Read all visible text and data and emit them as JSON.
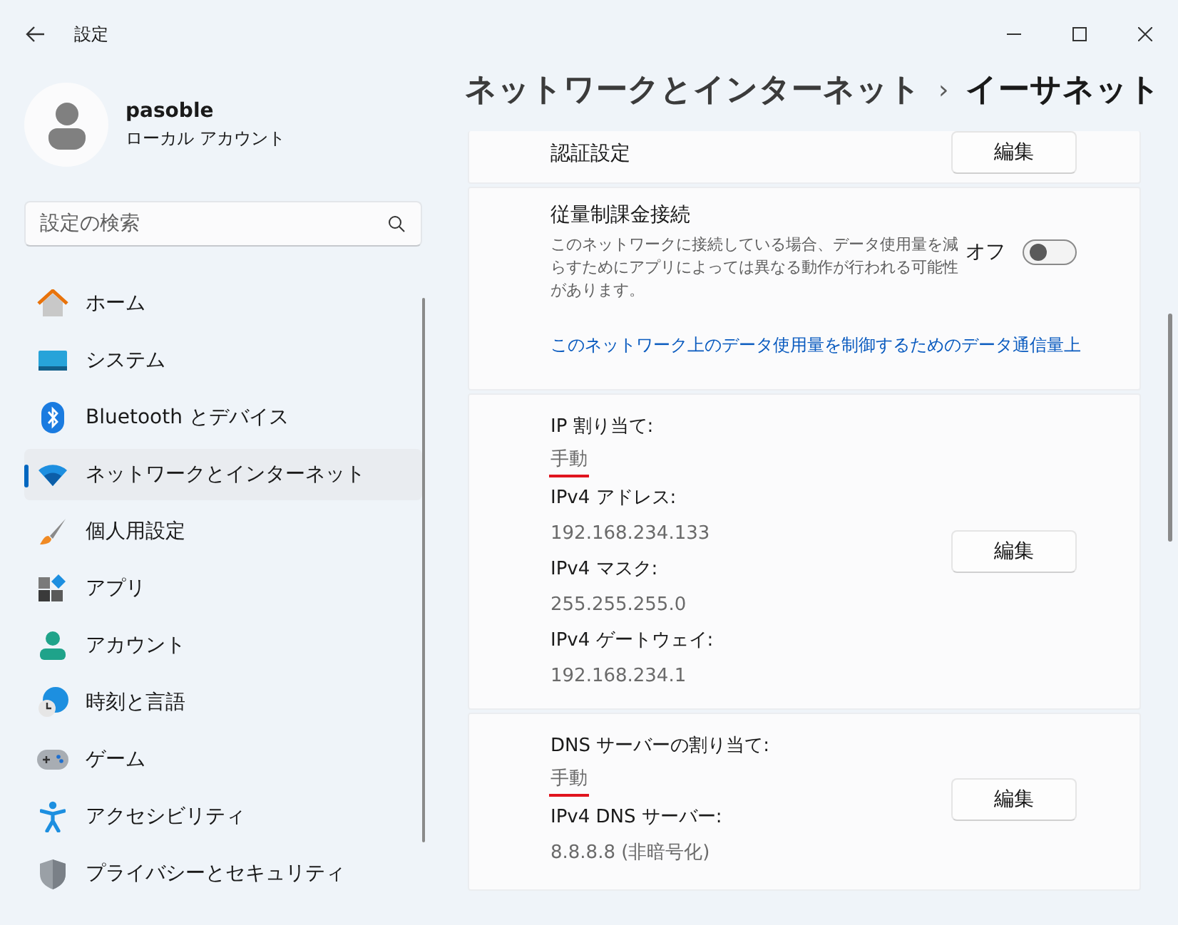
{
  "window": {
    "title": "設定"
  },
  "user": {
    "name": "pasoble",
    "account_type": "ローカル アカウント"
  },
  "search": {
    "placeholder": "設定の検索"
  },
  "nav": [
    {
      "label": "ホーム",
      "kind": "home",
      "selected": false
    },
    {
      "label": "システム",
      "kind": "system",
      "selected": false
    },
    {
      "label": "Bluetooth とデバイス",
      "kind": "bluetooth",
      "selected": false
    },
    {
      "label": "ネットワークとインターネット",
      "kind": "network",
      "selected": true
    },
    {
      "label": "個人用設定",
      "kind": "brush",
      "selected": false
    },
    {
      "label": "アプリ",
      "kind": "apps",
      "selected": false
    },
    {
      "label": "アカウント",
      "kind": "account",
      "selected": false
    },
    {
      "label": "時刻と言語",
      "kind": "time",
      "selected": false
    },
    {
      "label": "ゲーム",
      "kind": "game",
      "selected": false
    },
    {
      "label": "アクセシビリティ",
      "kind": "accessibility",
      "selected": false
    },
    {
      "label": "プライバシーとセキュリティ",
      "kind": "shield",
      "selected": false
    }
  ],
  "breadcrumb": {
    "parent": "ネットワークとインターネット",
    "separator": "›",
    "current": "イーサネット"
  },
  "auth": {
    "label": "認証設定",
    "button": "編集"
  },
  "metered": {
    "title": "従量制課金接続",
    "description": "このネットワークに接続している場合、データ使用量を減らすためにアプリによっては異なる動作が行われる可能性があります。",
    "state_label": "オフ",
    "on": false,
    "link": "このネットワーク上のデータ使用量を制御するためのデータ通信量上"
  },
  "ip": {
    "button": "編集",
    "lines": [
      {
        "text": "IP 割り当て:",
        "kind": "label",
        "marked": false
      },
      {
        "text": "手動",
        "kind": "value",
        "marked": true
      },
      {
        "text": "IPv4 アドレス:",
        "kind": "label",
        "marked": false
      },
      {
        "text": "192.168.234.133",
        "kind": "value",
        "marked": false
      },
      {
        "text": "IPv4 マスク:",
        "kind": "label",
        "marked": false
      },
      {
        "text": "255.255.255.0",
        "kind": "value",
        "marked": false
      },
      {
        "text": "IPv4 ゲートウェイ:",
        "kind": "label",
        "marked": false
      },
      {
        "text": "192.168.234.1",
        "kind": "value",
        "marked": false
      }
    ]
  },
  "dns": {
    "button": "編集",
    "lines": [
      {
        "text": "DNS サーバーの割り当て:",
        "kind": "label",
        "marked": false
      },
      {
        "text": "手動",
        "kind": "value",
        "marked": true
      },
      {
        "text": "IPv4 DNS サーバー:",
        "kind": "label",
        "marked": false
      },
      {
        "text": "8.8.8.8 (非暗号化)",
        "kind": "value",
        "marked": false
      }
    ]
  }
}
